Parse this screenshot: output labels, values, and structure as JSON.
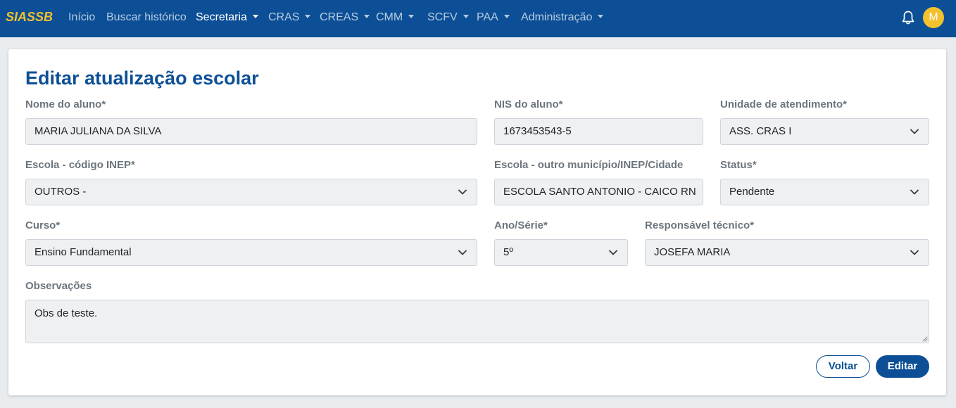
{
  "brand": "SIASSB",
  "nav": {
    "inicio": "Início",
    "buscar": "Buscar histórico",
    "secretaria": "Secretaria",
    "cras": "CRAS",
    "creas": "CREAS",
    "cmm": "CMM",
    "scfv": "SCFV",
    "paa": "PAA",
    "administracao": "Administração"
  },
  "user": {
    "initial": "M"
  },
  "form": {
    "title": "Editar atualização escolar",
    "nome_label": "Nome do aluno*",
    "nome_value": "MARIA JULIANA DA SILVA",
    "nis_label": "NIS do aluno*",
    "nis_value": "1673453543-5",
    "unidade_label": "Unidade de atendimento*",
    "unidade_value": "ASS. CRAS I",
    "escola_label": "Escola - código INEP*",
    "escola_value": "OUTROS -",
    "escola_outro_label": "Escola - outro município/INEP/Cidade",
    "escola_outro_value": "ESCOLA SANTO ANTONIO - CAICO RN",
    "status_label": "Status*",
    "status_value": "Pendente",
    "curso_label": "Curso*",
    "curso_value": "Ensino Fundamental",
    "ano_label": "Ano/Série*",
    "ano_value": "5º",
    "resp_label": "Responsável técnico*",
    "resp_value": "JOSEFA MARIA",
    "obs_label": "Observações",
    "obs_value": "Obs de teste."
  },
  "actions": {
    "voltar": "Voltar",
    "editar": "Editar"
  },
  "colors": {
    "primary": "#0c4f96",
    "accent": "#f2c12e",
    "field_bg": "#eff0f2"
  }
}
